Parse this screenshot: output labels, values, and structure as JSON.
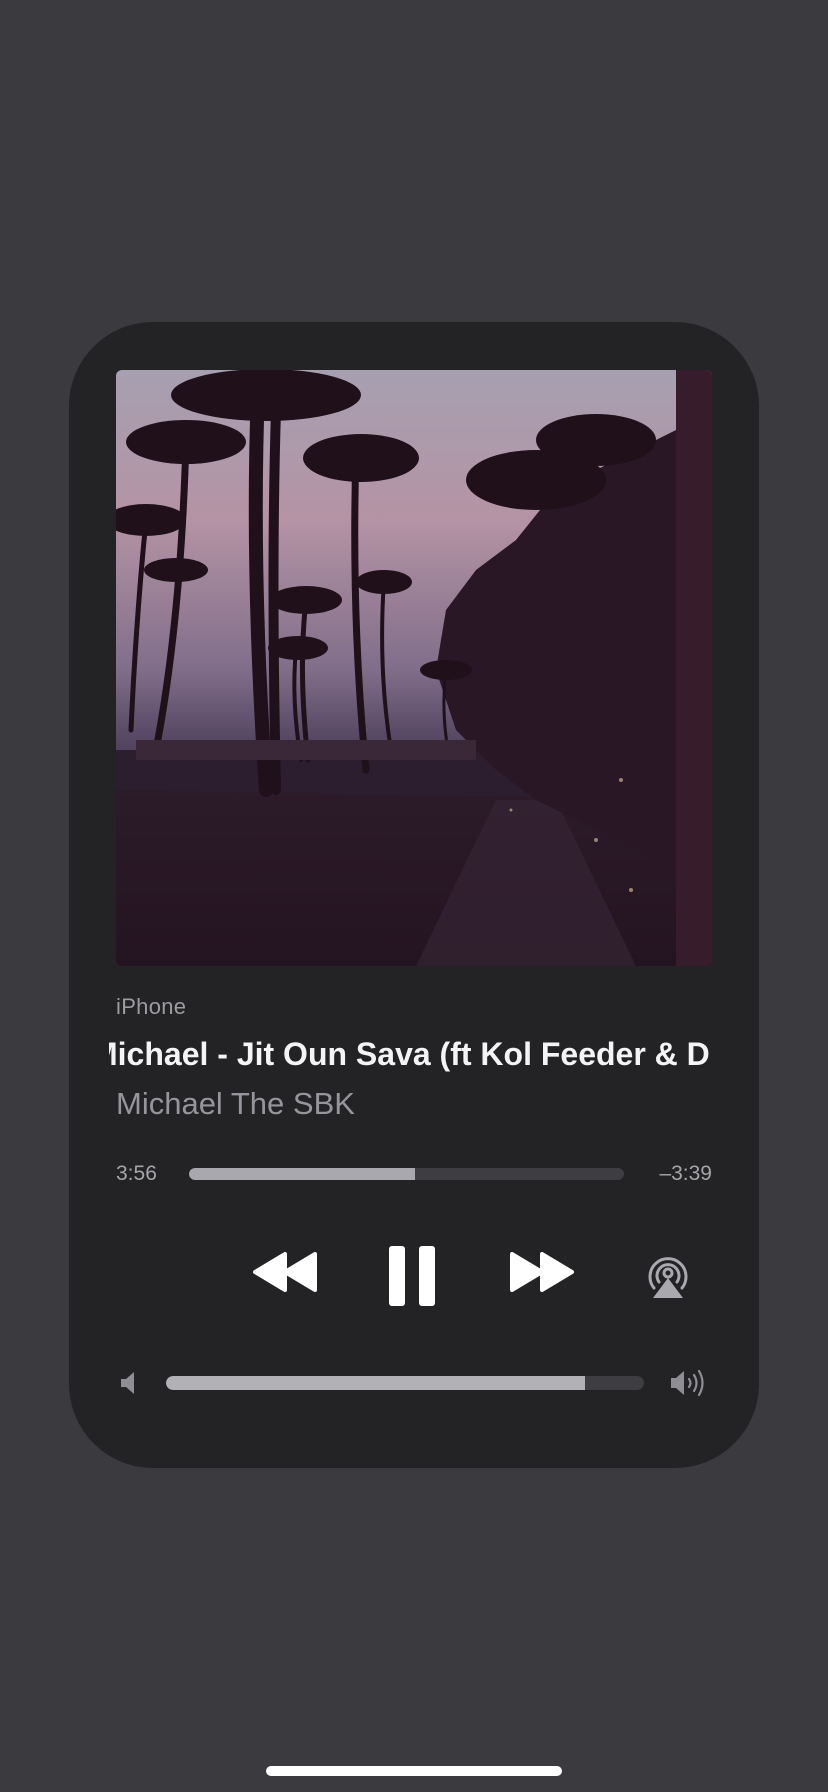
{
  "now_playing": {
    "source": "iPhone",
    "title": "Michael - Jit Oun Sava (ft Kol Feeder & D",
    "artist": "Michael The SBK",
    "elapsed": "3:56",
    "remaining": "–3:39",
    "progress": 0.52,
    "volume": 0.877,
    "artwork": "palm-trees-sunset-photo"
  },
  "icons": {
    "rewind": "rewind-icon",
    "pause": "pause-icon",
    "forward": "fast-forward-icon",
    "airplay": "airplay-icon",
    "volume_min": "speaker-min-icon",
    "volume_max": "speaker-max-icon"
  },
  "colors": {
    "background": "#3b3a3f",
    "card": "#232225",
    "accent_fill": "#a9a8ae",
    "track": "#3e3d42"
  }
}
